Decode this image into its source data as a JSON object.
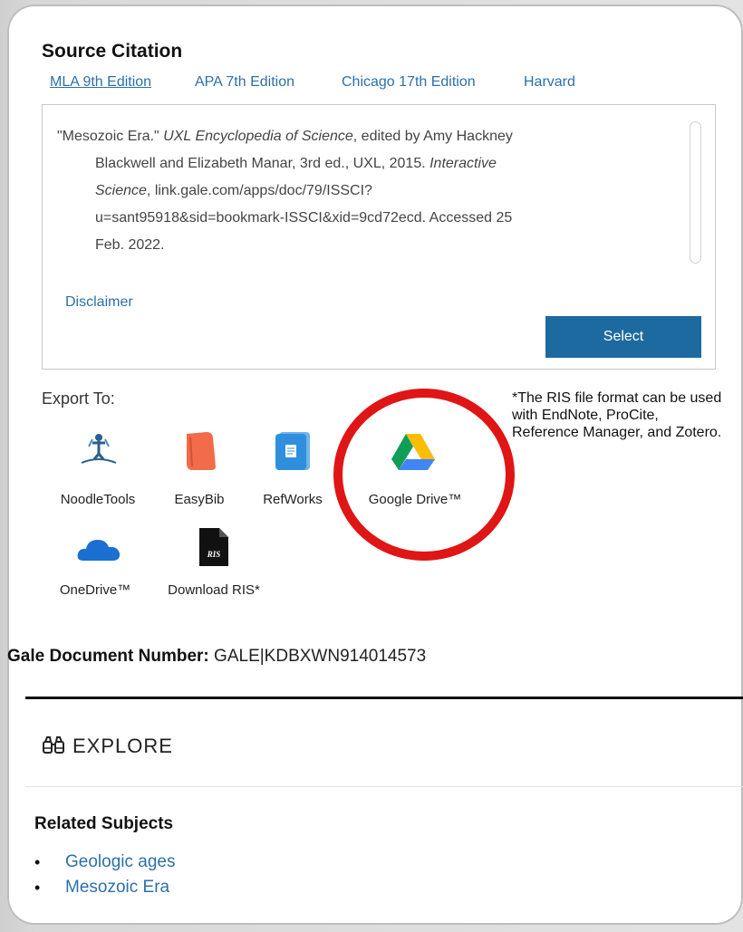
{
  "citation": {
    "title": "Source Citation",
    "tabs": [
      "MLA 9th Edition",
      "APA 7th Edition",
      "Chicago 17th Edition",
      "Harvard"
    ],
    "active_tab": "MLA 9th Edition",
    "text_lines": [
      {
        "parts": [
          {
            "t": "\"Mesozoic Era.\" ",
            "i": false
          },
          {
            "t": "UXL Encyclopedia of Science",
            "i": true
          },
          {
            "t": ", edited by Amy Hackney",
            "i": false
          }
        ]
      },
      {
        "parts": [
          {
            "t": "Blackwell and Elizabeth Manar, 3rd ed., UXL, 2015. ",
            "i": false
          },
          {
            "t": "Interactive",
            "i": true
          }
        ]
      },
      {
        "parts": [
          {
            "t": "Science",
            "i": true
          },
          {
            "t": ", link.gale.com/apps/doc/79/ISSCI?",
            "i": false
          }
        ]
      },
      {
        "parts": [
          {
            "t": "u=sant95918&sid=bookmark-ISSCI&xid=9cd72ecd. Accessed 25",
            "i": false
          }
        ]
      },
      {
        "parts": [
          {
            "t": "Feb. 2022.",
            "i": false
          }
        ]
      }
    ],
    "disclaimer_label": "Disclaimer",
    "select_label": "Select"
  },
  "export": {
    "label": "Export To:",
    "ris_note": "*The RIS file format can be used with EndNote, ProCite, Reference Manager, and Zotero.",
    "items": [
      {
        "label": "NoodleTools",
        "icon": "noodletools-icon"
      },
      {
        "label": "EasyBib",
        "icon": "easybib-icon"
      },
      {
        "label": "RefWorks",
        "icon": "refworks-icon"
      },
      {
        "label": "Google Drive™",
        "icon": "google-drive-icon"
      },
      {
        "label": "OneDrive™",
        "icon": "onedrive-icon"
      },
      {
        "label": "Download RIS*",
        "icon": "ris-file-icon"
      }
    ],
    "ris_icon_text": "RIS"
  },
  "document": {
    "number_label": "Gale Document Number:",
    "number_value": "GALE|KDBXWN914014573"
  },
  "explore": {
    "title": "EXPLORE",
    "related_title": "Related Subjects",
    "subjects": [
      "Geologic ages",
      "Mesozoic Era"
    ]
  },
  "colors": {
    "link": "#2d70a8",
    "select_button": "#1d6aa0",
    "annotation_circle": "#e01515"
  }
}
